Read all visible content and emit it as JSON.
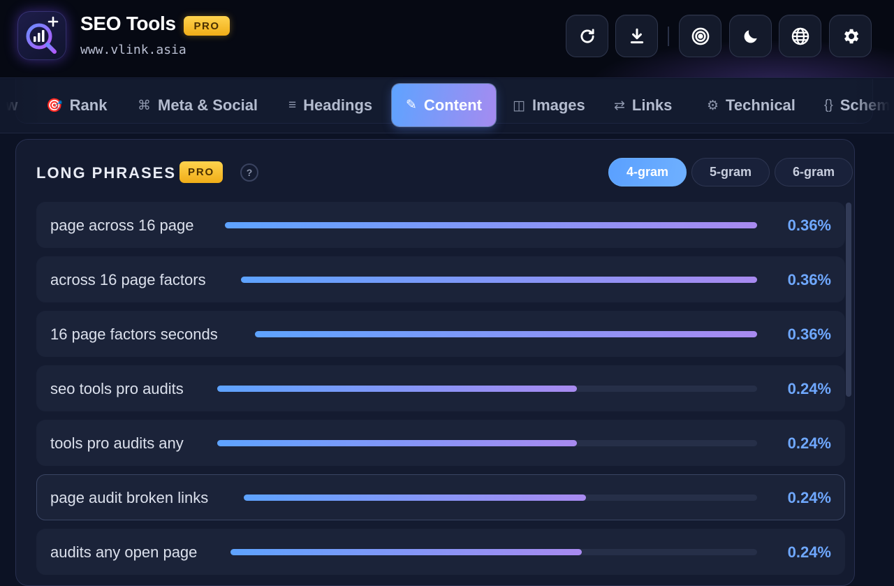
{
  "app": {
    "title": "SEO Tools",
    "badge": "PRO",
    "url": "www.vlink.asia",
    "accent": "#5ea3ff",
    "accent2": "#a88af0",
    "badge_color": "#f5c02c"
  },
  "header_actions": [
    {
      "icon": "refresh-icon"
    },
    {
      "icon": "download-icon"
    },
    {
      "icon": "target-icon"
    },
    {
      "icon": "moon-icon"
    },
    {
      "icon": "globe-icon"
    },
    {
      "icon": "gear-icon"
    }
  ],
  "tabs": [
    {
      "label": "ew",
      "icon": ""
    },
    {
      "label": "Rank",
      "icon": "🎯"
    },
    {
      "label": "Meta & Social",
      "icon": "⌘"
    },
    {
      "label": "Headings",
      "icon": "≡"
    },
    {
      "label": "Content",
      "icon": "✎",
      "active": true
    },
    {
      "label": "Images",
      "icon": "◫"
    },
    {
      "label": "Links",
      "icon": "⇄"
    },
    {
      "label": "Technical",
      "icon": "⚙"
    },
    {
      "label": "Schema",
      "icon": "{}"
    }
  ],
  "section": {
    "title": "LONG PHRASES",
    "badge": "PRO",
    "help": "?",
    "gram_options": [
      "4-gram",
      "5-gram",
      "6-gram"
    ],
    "selected_gram": "4-gram"
  },
  "phrases": [
    {
      "text": "page across 16 page",
      "percent": "0.36%",
      "value": 0.36
    },
    {
      "text": "across 16 page factors",
      "percent": "0.36%",
      "value": 0.36
    },
    {
      "text": "16 page factors seconds",
      "percent": "0.36%",
      "value": 0.36
    },
    {
      "text": "seo tools pro audits",
      "percent": "0.24%",
      "value": 0.24
    },
    {
      "text": "tools pro audits any",
      "percent": "0.24%",
      "value": 0.24
    },
    {
      "text": "page audit broken links",
      "percent": "0.24%",
      "value": 0.24
    },
    {
      "text": "audits any open page",
      "percent": "0.24%",
      "value": 0.24
    }
  ]
}
